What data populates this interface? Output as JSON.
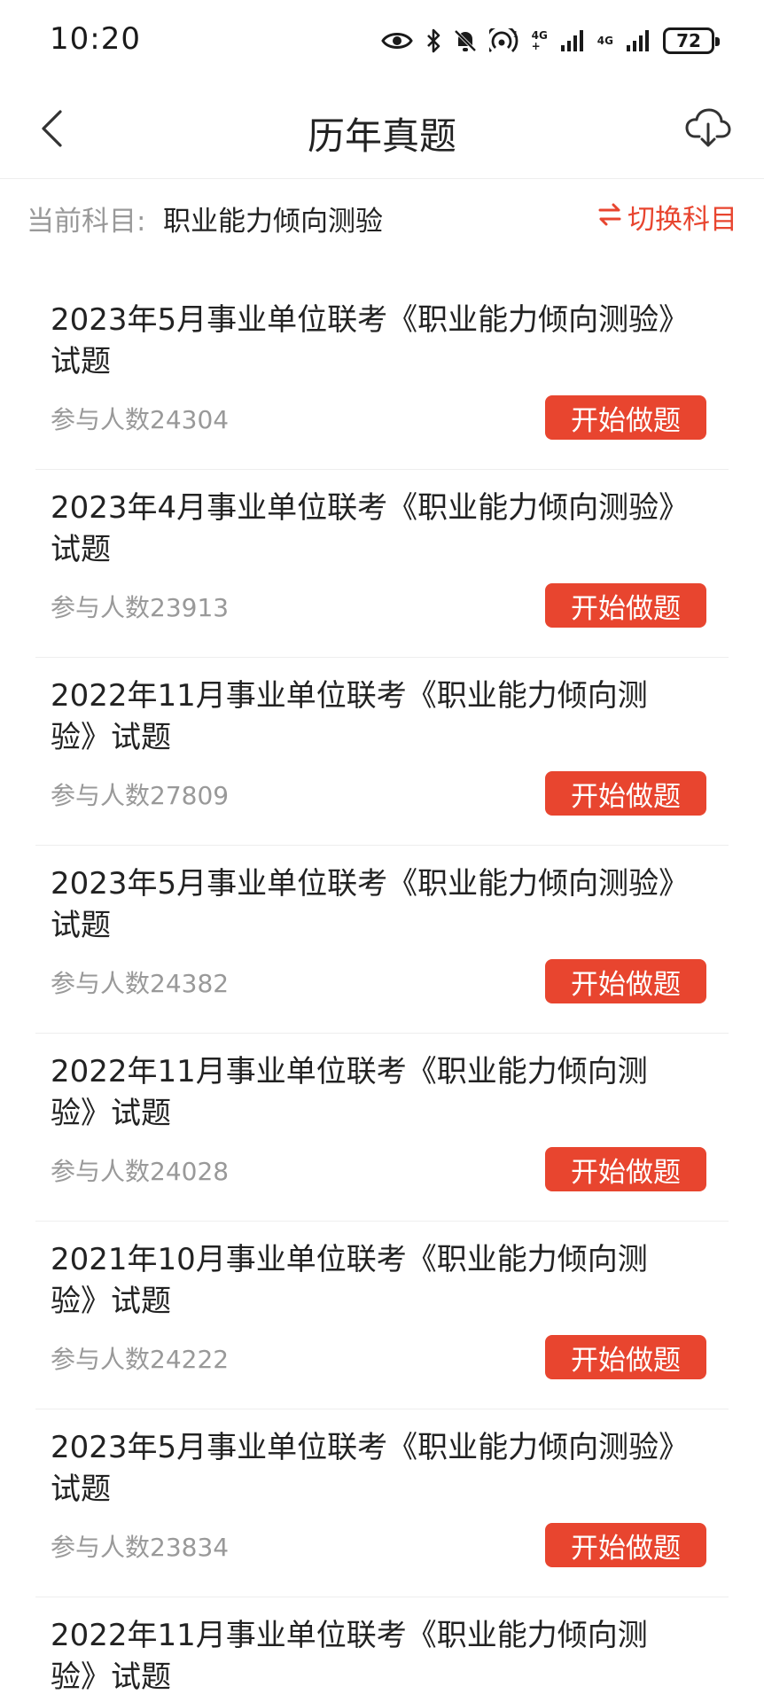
{
  "status_bar": {
    "time": "10:20",
    "battery": "72",
    "network_1": [
      "4G",
      "+"
    ],
    "network_2": [
      "4G",
      ""
    ],
    "icons": [
      "eye-icon",
      "bluetooth-icon",
      "bell-off-icon",
      "hotspot-icon",
      "signal-icon",
      "signal-icon",
      "battery-icon"
    ]
  },
  "header": {
    "title": "历年真题",
    "back_icon": "chevron-left-icon",
    "download_icon": "cloud-download-icon"
  },
  "subject": {
    "label": "当前科目:",
    "value": "职业能力倾向测验",
    "switch_label": "切换科目",
    "switch_icon": "swap-icon"
  },
  "papers": [
    {
      "title": "2023年5月事业单位联考《职业能力倾向测验》试题",
      "count": "参与人数24304",
      "button": "开始做题"
    },
    {
      "title": "2023年4月事业单位联考《职业能力倾向测验》试题",
      "count": "参与人数23913",
      "button": "开始做题"
    },
    {
      "title": "2022年11月事业单位联考《职业能力倾向测验》试题",
      "count": "参与人数27809",
      "button": "开始做题"
    },
    {
      "title": "2023年5月事业单位联考《职业能力倾向测验》试题",
      "count": "参与人数24382",
      "button": "开始做题"
    },
    {
      "title": "2022年11月事业单位联考《职业能力倾向测验》试题",
      "count": "参与人数24028",
      "button": "开始做题"
    },
    {
      "title": "2021年10月事业单位联考《职业能力倾向测验》试题",
      "count": "参与人数24222",
      "button": "开始做题"
    },
    {
      "title": "2023年5月事业单位联考《职业能力倾向测验》试题",
      "count": "参与人数23834",
      "button": "开始做题"
    },
    {
      "title": "2022年11月事业单位联考《职业能力倾向测验》试题",
      "count": "",
      "button": ""
    }
  ],
  "colors": {
    "accent": "#e8452f",
    "text_primary": "#222222",
    "text_secondary": "#999999",
    "divider": "#eeeeee"
  }
}
